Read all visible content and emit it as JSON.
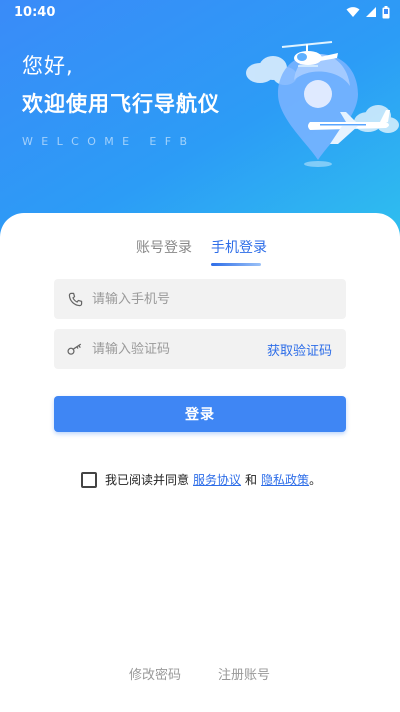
{
  "status_bar": {
    "time": "10:40"
  },
  "hero": {
    "greeting": "您好,",
    "title": "欢迎使用飞行导航仪",
    "subtitle": "WELCOME EFB"
  },
  "tabs": [
    {
      "label": "账号登录",
      "active": false
    },
    {
      "label": "手机登录",
      "active": true
    }
  ],
  "form": {
    "phone_placeholder": "请输入手机号",
    "code_placeholder": "请输入验证码",
    "get_code_label": "获取验证码",
    "login_label": "登录"
  },
  "agreement": {
    "checked": false,
    "prefix": "我已阅读并同意",
    "service_link": "服务协议",
    "and": "和",
    "privacy_link": "隐私政策",
    "suffix": "。"
  },
  "footer": {
    "change_password": "修改密码",
    "register": "注册账号"
  },
  "colors": {
    "accent": "#3f86f4",
    "link": "#2d6de8",
    "hero_start": "#3a8bf8",
    "hero_end": "#2fc1ee"
  },
  "icons": [
    "wifi-icon",
    "signal-icon",
    "battery-icon",
    "phone-icon",
    "key-icon",
    "map-pin-icon",
    "helicopter-icon",
    "airplane-icon"
  ]
}
